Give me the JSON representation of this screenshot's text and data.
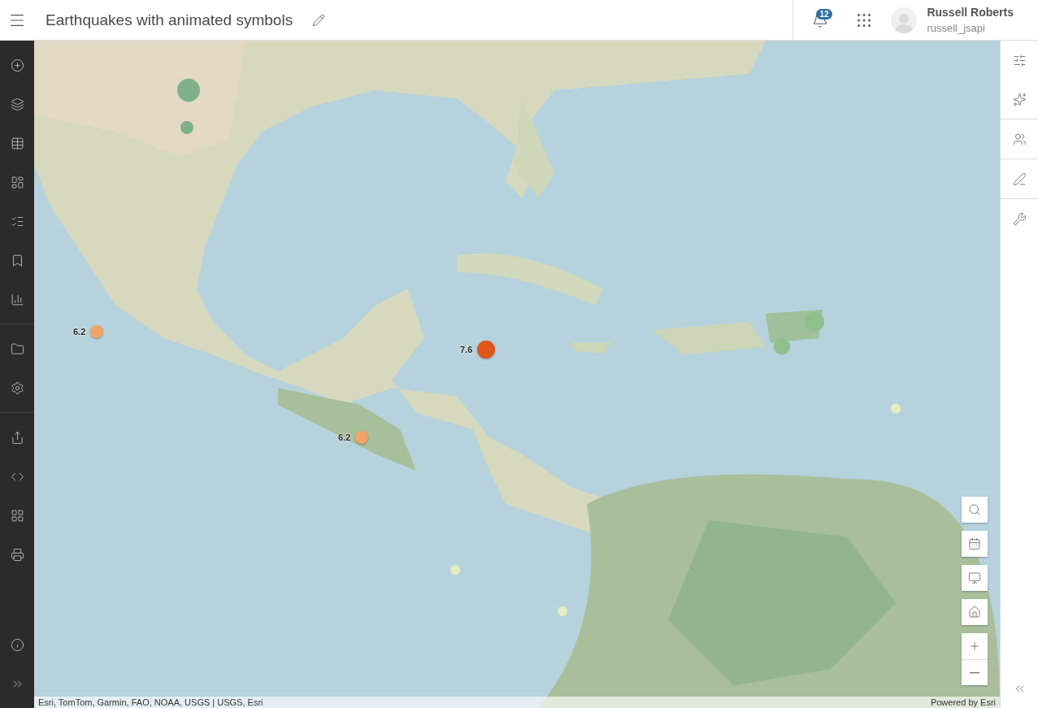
{
  "header": {
    "title": "Earthquakes with animated symbols",
    "notification_count": "12",
    "user": {
      "name": "Russell Roberts",
      "username": "russell_jsapi"
    }
  },
  "map": {
    "kind": "picture",
    "quakes": [
      {
        "magnitude": "6.2",
        "color": "#f2a468"
      },
      {
        "magnitude": "7.6",
        "color": "#e0561c"
      },
      {
        "magnitude": "6.2",
        "color": "#f2a468"
      }
    ],
    "attribution": "Esri, TomTom, Garmin, FAO, NOAA, USGS | USGS, Esri",
    "powered_by": "Powered by Esri"
  }
}
